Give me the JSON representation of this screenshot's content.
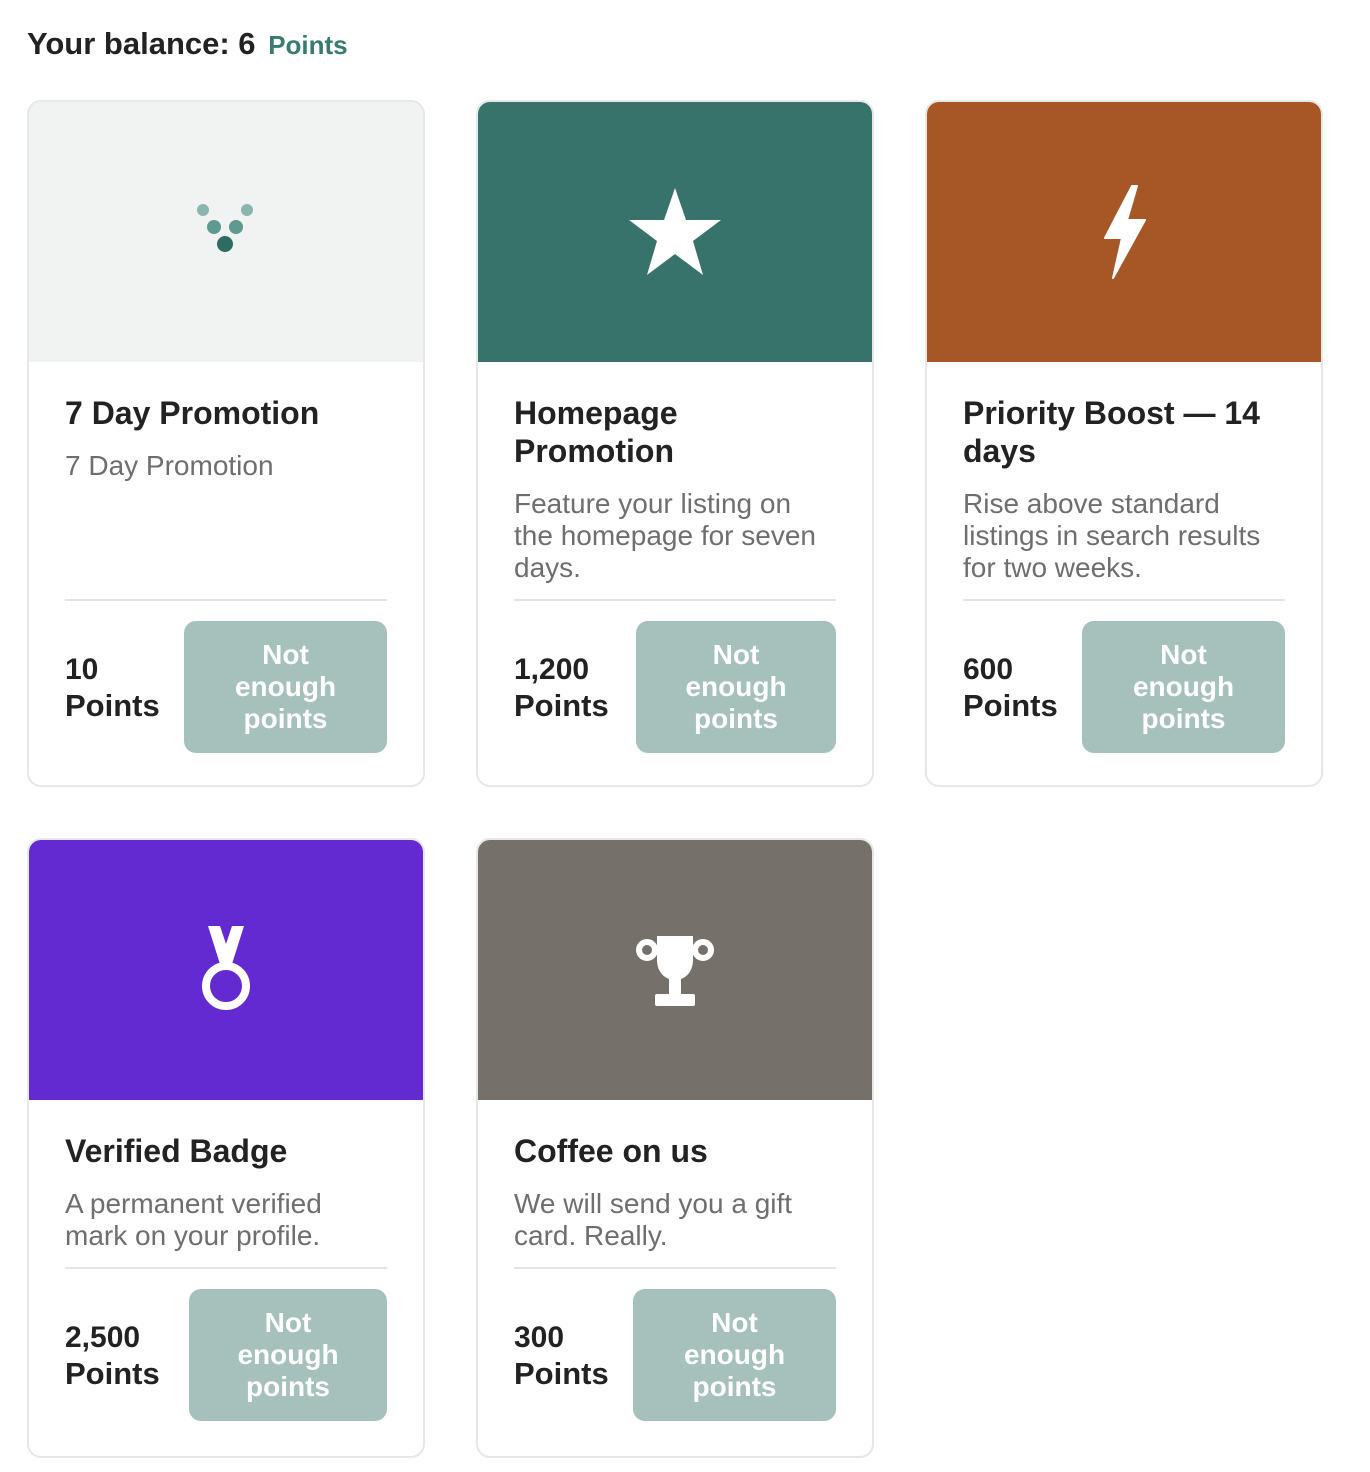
{
  "balance": {
    "label": "Your balance: 6",
    "unit": "Points"
  },
  "colors": {
    "accent": "#3a7a70",
    "button_disabled": "#a6c0bb"
  },
  "rewards": [
    {
      "title": "7 Day Promotion",
      "description": "7 Day Promotion",
      "price_value": "10",
      "price_unit": "Points",
      "button_label": "Not enough points",
      "icon": "dots-logo-icon",
      "hero_color": "#f0f3f2"
    },
    {
      "title": "Homepage Promotion",
      "description": "Feature your listing on the homepage for seven days.",
      "price_value": "1,200",
      "price_unit": "Points",
      "button_label": "Not enough points",
      "icon": "star-icon",
      "hero_color": "#37726b"
    },
    {
      "title": "Priority Boost — 14 days",
      "description": "Rise above standard listings in search results for two weeks.",
      "price_value": "600",
      "price_unit": "Points",
      "button_label": "Not enough points",
      "icon": "lightning-bolt-icon",
      "hero_color": "#a65725"
    },
    {
      "title": "Verified Badge",
      "description": "A permanent verified mark on your profile.",
      "price_value": "2,500",
      "price_unit": "Points",
      "button_label": "Not enough points",
      "icon": "medal-icon",
      "hero_color": "#632ad2"
    },
    {
      "title": "Coffee on us",
      "description": "We will send you a gift card. Really.",
      "price_value": "300",
      "price_unit": "Points",
      "button_label": "Not enough points",
      "icon": "trophy-icon",
      "hero_color": "#76706b"
    }
  ]
}
